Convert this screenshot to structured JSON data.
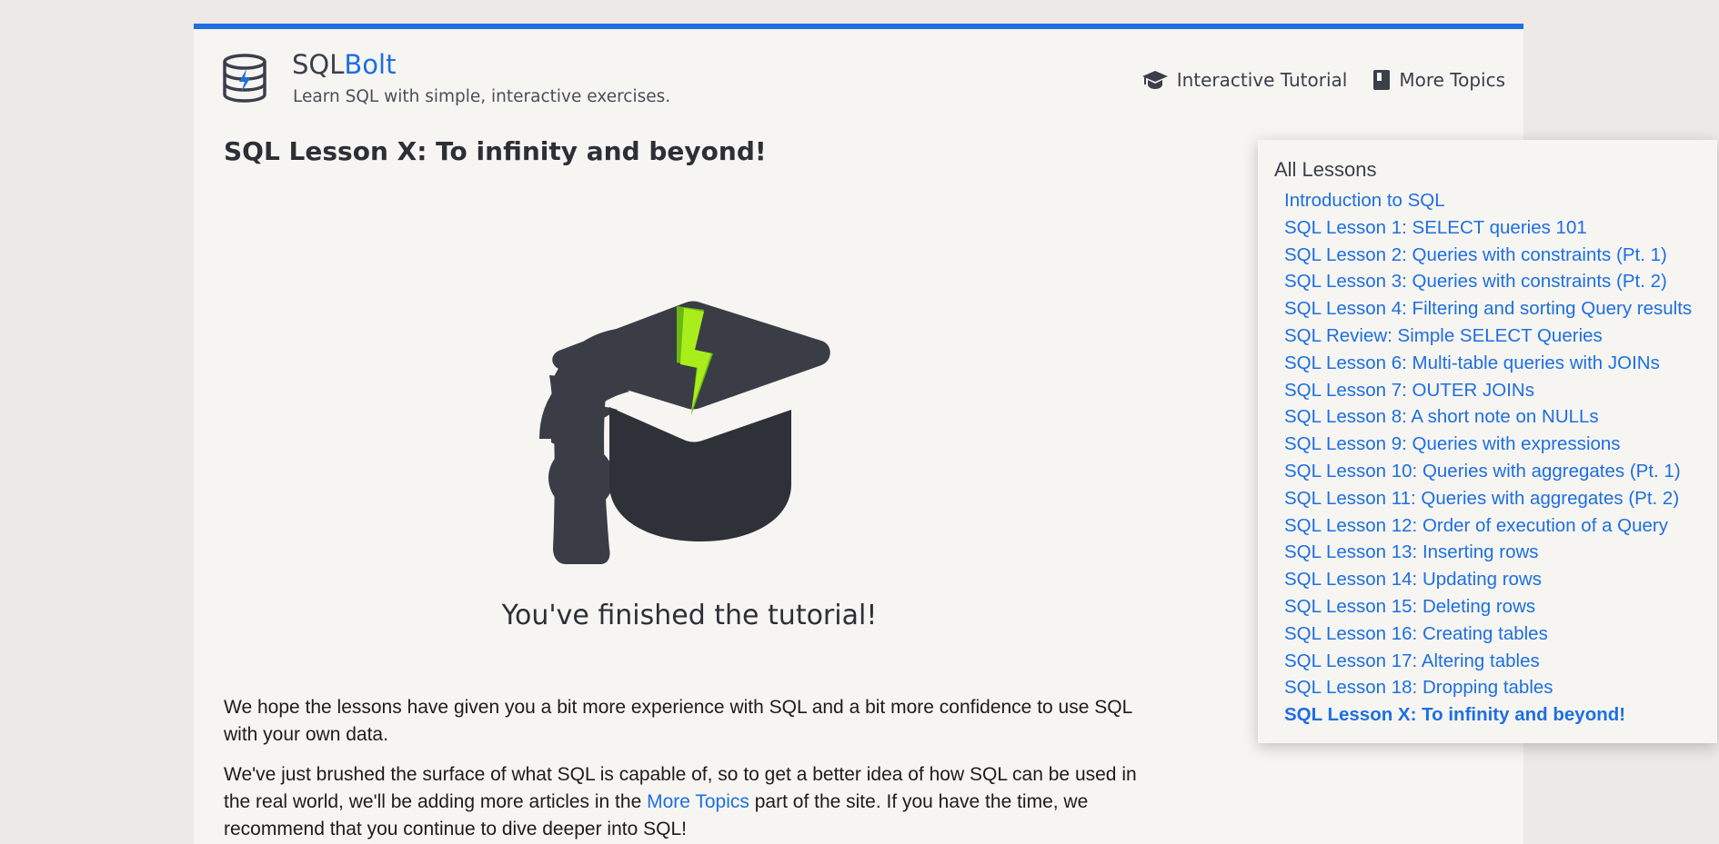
{
  "header": {
    "brand_main": "SQL",
    "brand_accent": "Bolt",
    "tagline": "Learn SQL with simple, interactive exercises."
  },
  "nav": {
    "tutorial": "Interactive Tutorial",
    "more_topics": "More Topics"
  },
  "lesson": {
    "title": "SQL Lesson X: To infinity and beyond!",
    "finished": "You've finished the tutorial!",
    "para1": "We hope the lessons have given you a bit more experience with SQL and a bit more confidence to use SQL with your own data.",
    "para2_before": "We've just brushed the surface of what SQL is capable of, so to get a better idea of how SQL can be used in the real world, we'll be adding more articles in the ",
    "para2_link": "More Topics",
    "para2_after": " part of the site. If you have the time, we recommend that you continue to dive deeper into SQL!"
  },
  "dropdown": {
    "heading": "All Lessons",
    "items": [
      "Introduction to SQL",
      "SQL Lesson 1: SELECT queries 101",
      "SQL Lesson 2: Queries with constraints (Pt. 1)",
      "SQL Lesson 3: Queries with constraints (Pt. 2)",
      "SQL Lesson 4: Filtering and sorting Query results",
      "SQL Review: Simple SELECT Queries",
      "SQL Lesson 6: Multi-table queries with JOINs",
      "SQL Lesson 7: OUTER JOINs",
      "SQL Lesson 8: A short note on NULLs",
      "SQL Lesson 9: Queries with expressions",
      "SQL Lesson 10: Queries with aggregates (Pt. 1)",
      "SQL Lesson 11: Queries with aggregates (Pt. 2)",
      "SQL Lesson 12: Order of execution of a Query",
      "SQL Lesson 13: Inserting rows",
      "SQL Lesson 14: Updating rows",
      "SQL Lesson 15: Deleting rows",
      "SQL Lesson 16: Creating tables",
      "SQL Lesson 17: Altering tables",
      "SQL Lesson 18: Dropping tables",
      "SQL Lesson X: To infinity and beyond!"
    ]
  },
  "icons": {
    "logo": "database-bolt-icon",
    "tutorial": "graduation-cap-icon",
    "more_topics": "book-icon",
    "hero": "graduation-cap-bolt-icon"
  },
  "colors": {
    "accent": "#1e6fe0",
    "bolt": "#9be31a",
    "hat": "#3a3d45"
  }
}
